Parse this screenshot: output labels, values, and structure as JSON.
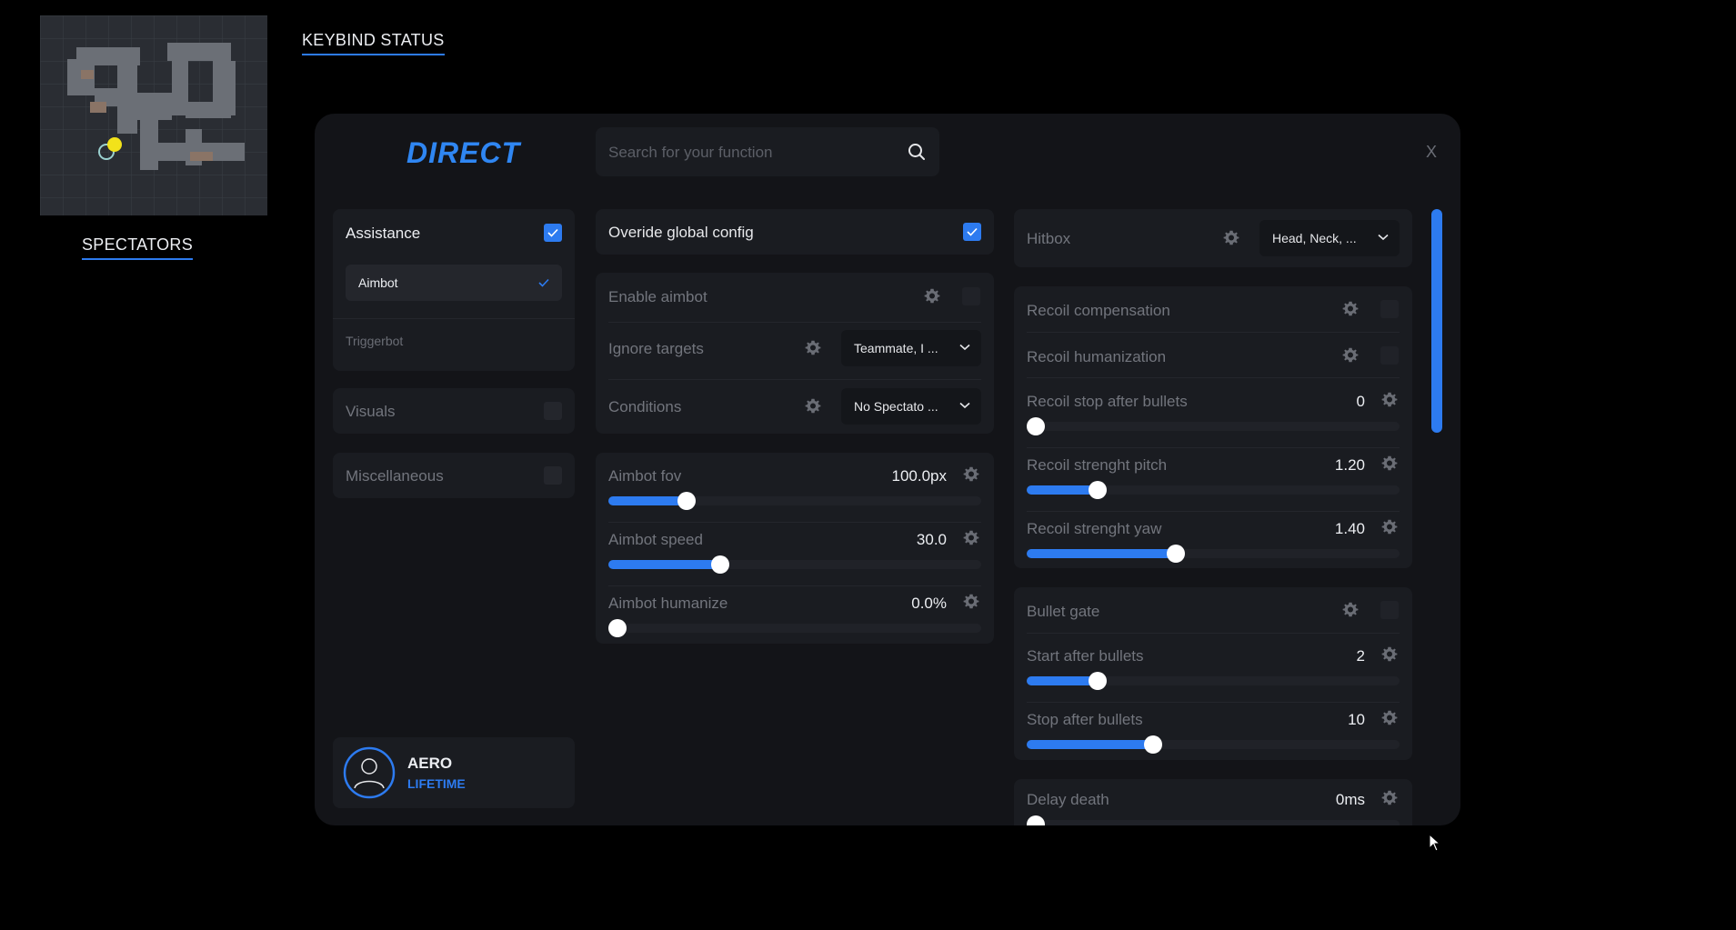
{
  "overlays": {
    "spectators_label": "SPECTATORS",
    "keybind_label": "KEYBIND STATUS"
  },
  "window": {
    "brand": "DIRECT",
    "search_placeholder": "Search for your function",
    "close_label": "X"
  },
  "nav": {
    "assistance": {
      "label": "Assistance",
      "checked": true
    },
    "sub_items": [
      {
        "label": "Aimbot",
        "active": true
      },
      {
        "label": "Triggerbot",
        "active": false
      }
    ],
    "visuals": {
      "label": "Visuals",
      "checked": false
    },
    "misc": {
      "label": "Miscellaneous",
      "checked": false
    }
  },
  "user": {
    "name": "AERO",
    "plan": "LIFETIME"
  },
  "center": {
    "override": {
      "label": "Overide global config",
      "checked": true
    },
    "enable_aimbot": "Enable aimbot",
    "ignore_targets": {
      "label": "Ignore targets",
      "value": "Teammate, I ..."
    },
    "conditions": {
      "label": "Conditions",
      "value": "No Spectato ..."
    },
    "sliders": [
      {
        "label": "Aimbot fov",
        "value": "100.0px",
        "level": 0.21
      },
      {
        "label": "Aimbot speed",
        "value": "30.0",
        "level": 0.3
      },
      {
        "label": "Aimbot humanize",
        "value": "0.0%",
        "level": 0.0
      }
    ]
  },
  "right": {
    "hitbox": {
      "label": "Hitbox",
      "value": "Head, Neck, ..."
    },
    "recoil_compensation": "Recoil compensation",
    "recoil_humanization": "Recoil humanization",
    "recoil_sliders": [
      {
        "label": "Recoil stop after bullets",
        "value": "0",
        "level": 0.0
      },
      {
        "label": "Recoil strenght pitch",
        "value": "1.20",
        "level": 0.19
      },
      {
        "label": "Recoil strenght yaw",
        "value": "1.40",
        "level": 0.4
      }
    ],
    "bullet_gate": "Bullet gate",
    "gate_sliders": [
      {
        "label": "Start after bullets",
        "value": "2",
        "level": 0.19
      },
      {
        "label": "Stop after bullets",
        "value": "10",
        "level": 0.34
      }
    ],
    "delay_death": {
      "label": "Delay death",
      "value": "0ms",
      "level": 0.0
    }
  },
  "colors": {
    "accent": "#2d7bf0",
    "panel": "#131418",
    "card": "#1a1c21",
    "muted_text": "#72757d"
  },
  "icons": [
    "search-icon",
    "gear-icon",
    "checkmark-icon",
    "chevron-down-icon",
    "user-icon",
    "cursor-icon"
  ]
}
